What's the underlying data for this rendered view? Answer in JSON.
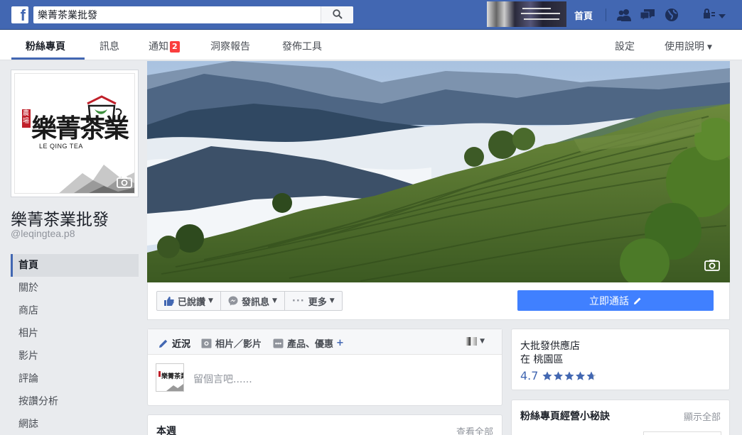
{
  "topbar": {
    "logo": "f",
    "search_value": "樂菁茶業批發",
    "home_label": "首頁"
  },
  "pagenav": {
    "tabs": [
      {
        "label": "粉絲專頁",
        "active": true
      },
      {
        "label": "訊息"
      },
      {
        "label": "通知",
        "badge": "2"
      },
      {
        "label": "洞察報告"
      },
      {
        "label": "發佈工具"
      }
    ],
    "settings_label": "設定",
    "help_label": "使用說明"
  },
  "profile": {
    "logo_main": "樂菁茶業",
    "logo_sub": "LE QING TEA",
    "logo_seal": "農場"
  },
  "page": {
    "name": "樂菁茶業批發",
    "handle": "@leqingtea.p8"
  },
  "sidenav": [
    "首頁",
    "關於",
    "商店",
    "相片",
    "影片",
    "評論",
    "按讚分析",
    "網誌"
  ],
  "actions": {
    "liked": "已說讚",
    "message": "發訊息",
    "more": "更多",
    "call": "立即通話"
  },
  "composer": {
    "tabs": [
      "近況",
      "相片／影片",
      "產品、優惠"
    ],
    "plus": "+",
    "placeholder": "留個言吧......"
  },
  "week": {
    "title": "本週",
    "link": "查看全部"
  },
  "info": {
    "line1": "大批發供應店",
    "line2": "在 桃園區",
    "rating": "4.7",
    "stars": 4.7
  },
  "tips": {
    "title": "粉絲專頁經營小秘訣",
    "link": "顯示全部"
  },
  "colors": {
    "brand": "#4267b2",
    "call_button": "#4080ff",
    "badge": "#fa3e3e"
  },
  "icons": [
    "search-icon",
    "camera-icon",
    "thumbs-up-icon",
    "messenger-icon",
    "ellipsis-icon",
    "pencil-icon",
    "photo-icon",
    "product-icon",
    "friends-icon",
    "messages-icon",
    "globe-icon",
    "lock-icon",
    "star-icon"
  ]
}
